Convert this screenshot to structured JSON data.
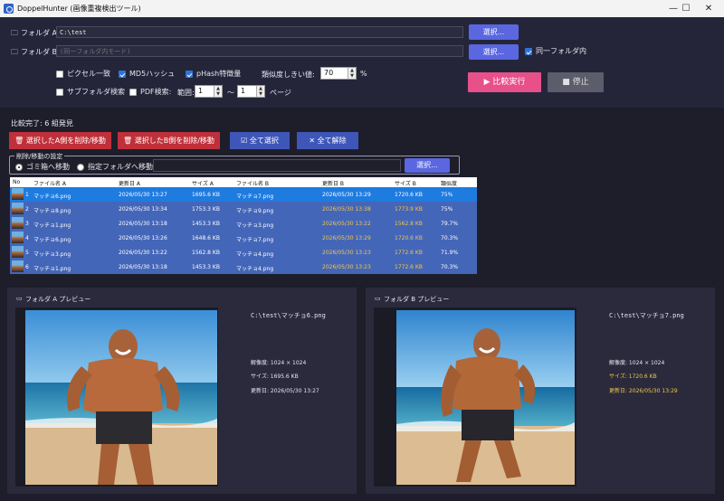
{
  "window": {
    "title": "DoppelHunter (画像重複検出ツール)",
    "minimize": "—",
    "maximize": "☐",
    "close": "✕"
  },
  "folders": {
    "a_label": "フォルダ A",
    "a_value": "C:\\test",
    "b_label": "フォルダ B",
    "b_placeholder": "(同一フォルダ内モード)",
    "select_label": "選択...",
    "same_folder_label": "同一フォルダ内",
    "same_folder_checked": true
  },
  "options": {
    "pixel_match": "ピクセル一致",
    "pixel_match_checked": false,
    "md5": "MD5ハッシュ",
    "md5_checked": true,
    "phash": "pHash特徴量",
    "phash_checked": true,
    "threshold_label": "類似度しきい値:",
    "threshold_value": "70",
    "threshold_unit": "%",
    "subfolder": "サブフォルダ検索",
    "subfolder_checked": false,
    "pdf": "PDF検索:",
    "pdf_checked": false,
    "range_label": "範囲:",
    "range_from": "1",
    "range_sep": "〜",
    "range_to": "1",
    "page_label": "ページ"
  },
  "actions": {
    "compare": "比較実行",
    "stop": "停止"
  },
  "status": "比較完了: 6 組発見",
  "bulk": {
    "delete_a": "選択したA側を削除/移動",
    "delete_b": "選択したB側を削除/移動",
    "select_all": "全て選択",
    "clear_all": "全て解除"
  },
  "move_settings": {
    "legend": "削除/移動の設定",
    "trash": "ゴミ箱へ移動",
    "trash_selected": true,
    "folder": "指定フォルダへ移動:",
    "folder_value": "",
    "select_label": "選択..."
  },
  "table": {
    "columns": [
      "No",
      "ファイル名 A",
      "更新日 A",
      "サイズ A",
      "ファイル名 B",
      "更新日 B",
      "サイズ B",
      "類似度"
    ],
    "rows": [
      {
        "no": "1",
        "file_a": "マッチョ6.png",
        "date_a": "2026/05/30 13:27",
        "size_a": "1695.6 KB",
        "file_b": "マッチョ7.png",
        "date_b": "2026/05/30 13:29",
        "size_b": "1720.6 KB",
        "similarity": "75%"
      },
      {
        "no": "2",
        "file_a": "マッチョ8.png",
        "date_a": "2026/05/30 13:34",
        "size_a": "1753.3 KB",
        "file_b": "マッチョ9.png",
        "date_b": "2026/05/30 13:38",
        "size_b": "1773.9 KB",
        "similarity": "75%"
      },
      {
        "no": "3",
        "file_a": "マッチョ1.png",
        "date_a": "2026/05/30 13:18",
        "size_a": "1453.3 KB",
        "file_b": "マッチョ3.png",
        "date_b": "2026/05/30 13:22",
        "size_b": "1562.8 KB",
        "similarity": "79.7%"
      },
      {
        "no": "4",
        "file_a": "マッチョ6.png",
        "date_a": "2026/05/30 13:26",
        "size_a": "1648.6 KB",
        "file_b": "マッチョ7.png",
        "date_b": "2026/05/30 13:29",
        "size_b": "1720.6 KB",
        "similarity": "70.3%"
      },
      {
        "no": "5",
        "file_a": "マッチョ3.png",
        "date_a": "2026/05/30 13:22",
        "size_a": "1562.8 KB",
        "file_b": "マッチョ4.png",
        "date_b": "2026/05/30 13:23",
        "size_b": "1772.6 KB",
        "similarity": "71.9%"
      },
      {
        "no": "6",
        "file_a": "マッチョ1.png",
        "date_a": "2026/05/30 13:18",
        "size_a": "1453.3 KB",
        "file_b": "マッチョ4.png",
        "date_b": "2026/05/30 13:23",
        "size_b": "1772.6 KB",
        "similarity": "70.3%"
      }
    ]
  },
  "preview_a": {
    "title": "フォルダ A プレビュー",
    "path": "C:\\test\\マッチョ6.png",
    "resolution": "解像度: 1024 × 1024",
    "size": "サイズ: 1695.6 KB",
    "modified": "更新日: 2026/05/30 13:27"
  },
  "preview_b": {
    "title": "フォルダ B プレビュー",
    "path": "C:\\test\\マッチョ7.png",
    "resolution": "解像度: 1024 × 1024",
    "size": "サイズ: 1720.6 KB",
    "modified": "更新日: 2026/05/30 13:29"
  },
  "colors": {
    "accent": "#5a67e0",
    "compare": "#e8508a",
    "danger": "#c0303a",
    "selected_row": "#1e7be0",
    "row": "#4466b8",
    "highlight": "#f2c64a"
  }
}
